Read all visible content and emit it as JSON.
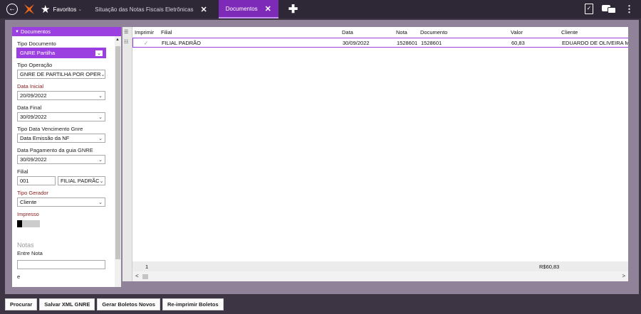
{
  "topbar": {
    "favoritos_label": "Favoritos",
    "tabs": [
      {
        "label": "Situação das Notas Fiscais Eletrônicas",
        "active": false
      },
      {
        "label": "Documentos",
        "active": true
      }
    ]
  },
  "filters": {
    "header": "Documentos",
    "tipo_documento": {
      "label": "Tipo Documento",
      "value": "GNRE Partilha"
    },
    "tipo_operacao": {
      "label": "Tipo Operação",
      "value": "GNRE DE PARTILHA POR OPER"
    },
    "data_inicial": {
      "label": "Data Inicial",
      "value": "20/09/2022"
    },
    "data_final": {
      "label": "Data Final",
      "value": "30/09/2022"
    },
    "tipo_data_venc": {
      "label": "Tipo Data Vencimento Gnre",
      "value": "Data Emissão da NF"
    },
    "data_pagamento": {
      "label": "Data Pagamento da guia GNRE",
      "value": "30/09/2022"
    },
    "filial": {
      "label": "Filial",
      "code": "001",
      "name": "FILIAL PADRÃC"
    },
    "tipo_gerador": {
      "label": "Tipo Gerador",
      "value": "Cliente"
    },
    "impresso": {
      "label": "Impresso",
      "value": false
    },
    "notas_section": "Notas",
    "entre_nota": {
      "label": "Entre Nota",
      "value": ""
    },
    "e_label": "e"
  },
  "grid": {
    "columns": [
      "Imprimir",
      "Filial",
      "Data",
      "Nota",
      "Documento",
      "Valor",
      "Cliente"
    ],
    "rows": [
      {
        "imprimir": true,
        "filial": "FILIAL PADRÃO",
        "data": "30/09/2022",
        "nota": "1528601",
        "documento": "1528601",
        "valor": "60,83",
        "cliente": "EDUARDO DE OLIVEIRA MA"
      }
    ],
    "footer": {
      "count": "1",
      "total": "R$60,83"
    }
  },
  "actions": {
    "procurar": "Procurar",
    "salvar_xml": "Salvar XML GNRE",
    "gerar_boletos": "Gerar Boletos Novos",
    "reimprimir": "Re-imprimir Boletos"
  }
}
